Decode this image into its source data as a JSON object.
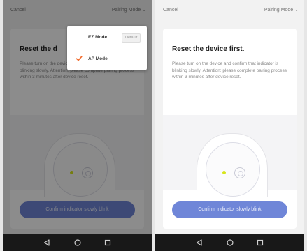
{
  "colors": {
    "accent": "#6f86d8",
    "check": "#f26b2c",
    "frame": "#4a7a5a",
    "led": "#d7e51b"
  },
  "icons": [
    "chevron-down-icon",
    "check-icon",
    "back-icon",
    "home-icon",
    "recents-icon"
  ],
  "header": {
    "cancel": "Cancel",
    "mode": "Pairing Mode"
  },
  "card": {
    "title": "Reset the device first.",
    "title_partial": "Reset the d",
    "instructions": "Please turn on the device and confirm that indicator is blinking slowly. Attention: please complete pairing process within 3 minutes after device reset.",
    "confirm_button": "Confirm indicator slowly blink"
  },
  "dropdown": {
    "items": [
      {
        "label": "EZ Mode",
        "badge": "Default",
        "selected": false
      },
      {
        "label": "AP Mode",
        "badge": "",
        "selected": true
      }
    ]
  }
}
